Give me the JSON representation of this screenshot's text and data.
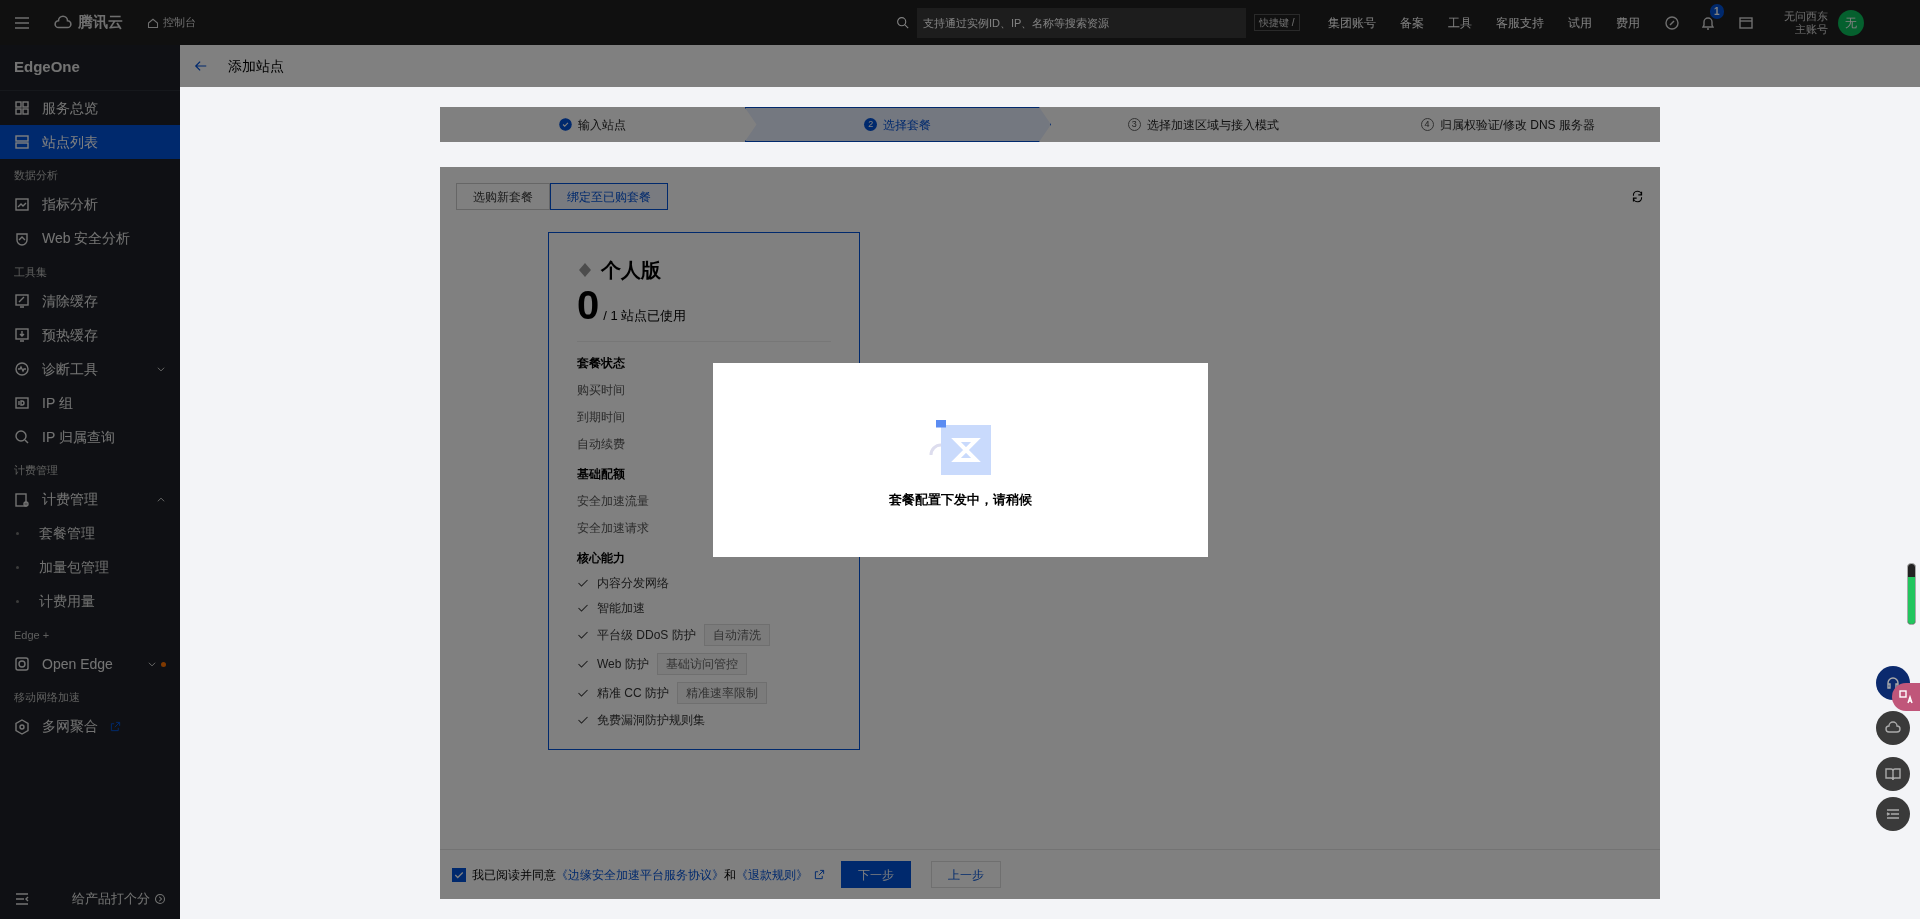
{
  "topbar": {
    "brand": "腾讯云",
    "console": "控制台",
    "search_placeholder": "支持通过实例ID、IP、名称等搜索资源",
    "shortcut": "快捷键 /",
    "links": [
      "集团账号",
      "备案",
      "工具",
      "客服支持",
      "试用",
      "费用"
    ],
    "notification_count": "1",
    "user": {
      "name": "无问西东",
      "role": "主账号",
      "avatar": "无"
    }
  },
  "sidebar": {
    "product": "EdgeOne",
    "groups": [
      {
        "items": [
          {
            "label": "服务总览",
            "selected": false
          },
          {
            "label": "站点列表",
            "selected": true
          }
        ]
      },
      {
        "title": "数据分析",
        "items": [
          {
            "label": "指标分析",
            "selected": false
          },
          {
            "label": "Web 安全分析",
            "selected": false
          }
        ]
      },
      {
        "title": "工具集",
        "items": [
          {
            "label": "清除缓存",
            "selected": false
          },
          {
            "label": "预热缓存",
            "selected": false
          },
          {
            "label": "诊断工具",
            "selected": false,
            "expanded": false
          },
          {
            "label": "IP 组",
            "selected": false
          },
          {
            "label": "IP 归属查询",
            "selected": false
          }
        ]
      },
      {
        "title": "计费管理",
        "items": [
          {
            "label": "计费管理",
            "selected": false,
            "expanded": true,
            "children": [
              {
                "label": "套餐管理",
                "selected": false
              },
              {
                "label": "加量包管理",
                "selected": false
              },
              {
                "label": "计费用量",
                "selected": false
              }
            ]
          }
        ]
      },
      {
        "title": "Edge +",
        "items": [
          {
            "label": "Open Edge",
            "selected": false,
            "expanded": false,
            "notice": true
          }
        ]
      },
      {
        "title": "移动网络加速",
        "items": [
          {
            "label": "多网聚合",
            "selected": false,
            "external": true
          }
        ]
      }
    ],
    "feedback": "给产品打个分"
  },
  "page": {
    "title": "添加站点",
    "steps": [
      {
        "label": "输入站点",
        "completed": true,
        "selected": false
      },
      {
        "number": "2",
        "label": "选择套餐",
        "completed": false,
        "selected": true
      },
      {
        "number": "3",
        "label": "选择加速区域与接入模式",
        "completed": false,
        "selected": false
      },
      {
        "number": "4",
        "label": "归属权验证/修改 DNS 服务器",
        "completed": false,
        "selected": false
      }
    ],
    "tabs": [
      {
        "label": "选购新套餐",
        "selected": false
      },
      {
        "label": "绑定至已购套餐",
        "selected": true
      }
    ],
    "plan": {
      "name": "个人版",
      "selected": true,
      "used": "0",
      "quota": "/ 1 站点已使用",
      "sections": [
        {
          "kind": "rows",
          "title": "套餐状态",
          "rows": [
            "购买时间",
            "到期时间",
            "自动续费"
          ]
        },
        {
          "kind": "rows",
          "title": "基础配额",
          "rows": [
            "安全加速流量",
            "安全加速请求"
          ]
        },
        {
          "kind": "features",
          "title": "核心能力",
          "features": [
            {
              "label": "内容分发网络"
            },
            {
              "label": "智能加速"
            },
            {
              "label": "平台级 DDoS 防护",
              "tag": "自动清洗"
            },
            {
              "label": "Web 防护",
              "tag": "基础访问管控"
            },
            {
              "label": "精准 CC 防护",
              "tag": "精准速率限制"
            },
            {
              "label": "免费漏洞防护规则集"
            }
          ]
        }
      ]
    },
    "agreement": {
      "checked": true,
      "prefix": "我已阅读并同意",
      "link_1": "《边缘安全加速平台服务协议》",
      "conjunction": "和",
      "link_2": "《退款规则》"
    },
    "buttons": {
      "next": "下一步",
      "prev": "上一步"
    }
  },
  "modal": {
    "message": "套餐配置下发中，请稍候"
  },
  "side_widget": {
    "level": 0.78
  }
}
